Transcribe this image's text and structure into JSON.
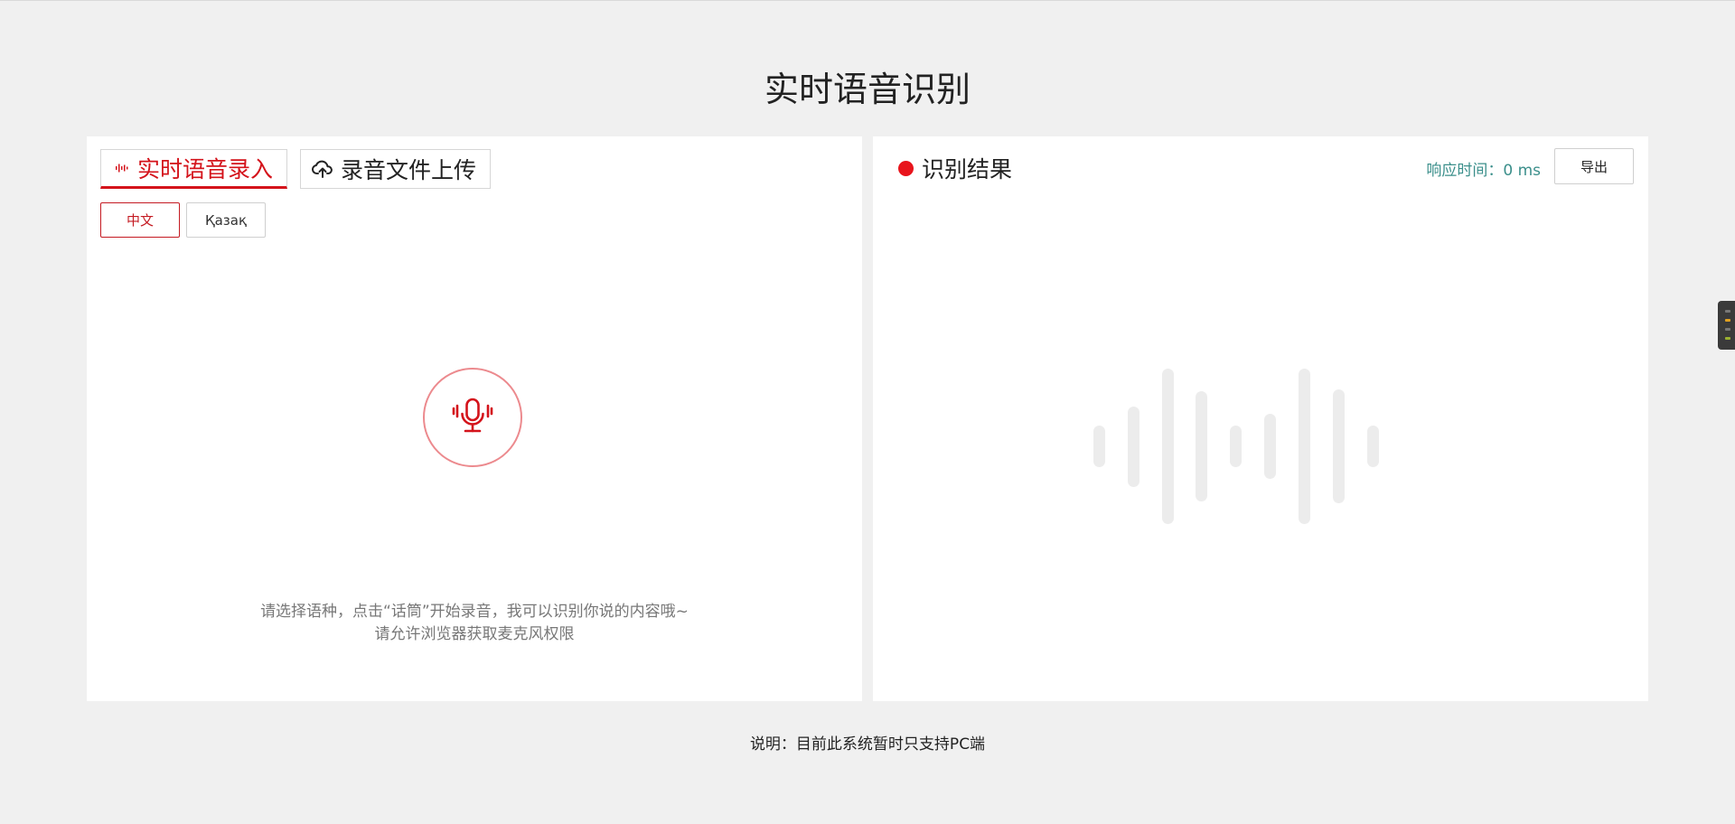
{
  "page": {
    "title": "实时语音识别",
    "footer_note": "说明：目前此系统暂时只支持PC端"
  },
  "left_panel": {
    "tabs": [
      {
        "label": "实时语音录入",
        "icon": "soundwave-icon",
        "active": true
      },
      {
        "label": "录音文件上传",
        "icon": "cloud-upload-icon",
        "active": false
      }
    ],
    "languages": [
      {
        "label": "中文",
        "selected": true
      },
      {
        "label": "Қазақ",
        "selected": false
      }
    ],
    "mic_icon": "microphone-icon",
    "hint_line1": "请选择语种，点击“话筒”开始录音，我可以识别你说的内容哦~",
    "hint_line2": "请允许浏览器获取麦克风权限"
  },
  "right_panel": {
    "title": "识别结果",
    "response_time": "响应时间：0 ms",
    "export_label": "导出",
    "placeholder_icon": "audio-waveform-icon"
  },
  "colors": {
    "accent_red": "#d4131b",
    "teal_text": "#3b8f8b",
    "background": "#f0f0f0",
    "waveform_placeholder": "#ececec"
  }
}
